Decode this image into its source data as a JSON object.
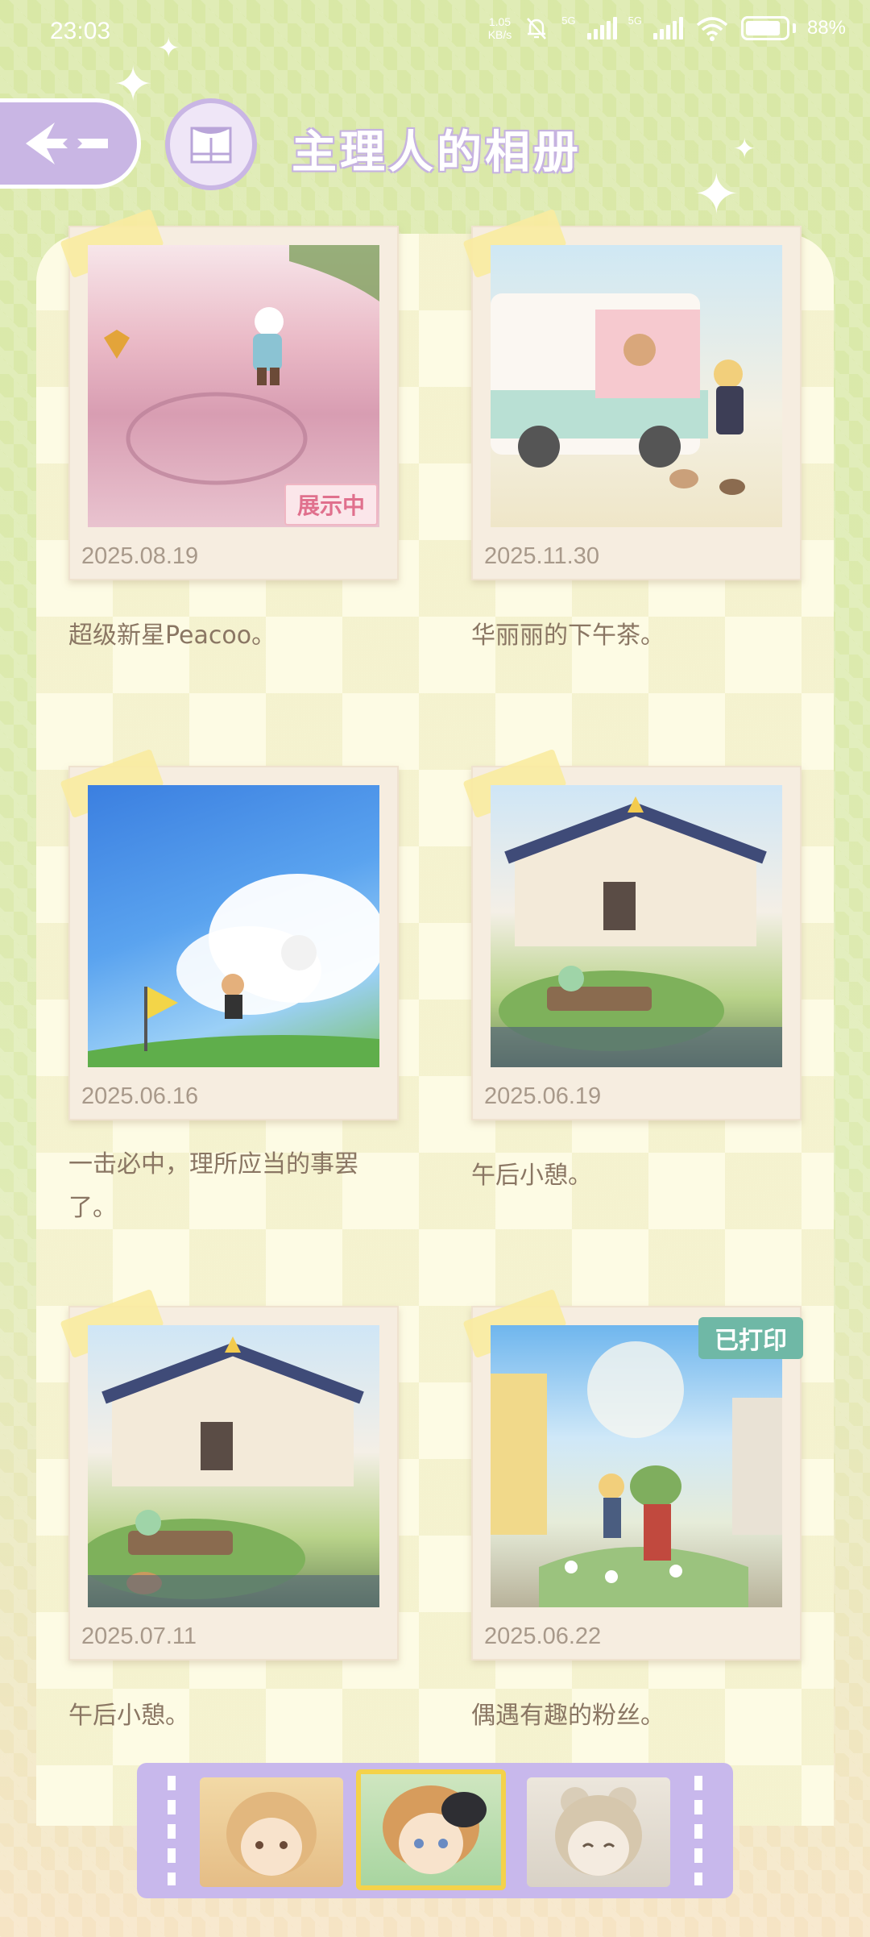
{
  "status_bar": {
    "time": "23:03",
    "net_speed_value": "1.05",
    "net_speed_unit": "KB/s",
    "sim1": "5G",
    "sim2": "5G",
    "battery": "88%"
  },
  "header": {
    "title": "主理人的相册"
  },
  "photos": [
    {
      "date": "2025.08.19",
      "caption": "超级新星Peacoo。",
      "badge": "展示中"
    },
    {
      "date": "2025.11.30",
      "caption": "华丽丽的下午茶。"
    },
    {
      "date": "2025.06.16",
      "caption": "一击必中，理所应当的事罢了。"
    },
    {
      "date": "2025.06.19",
      "caption": "午后小憩。"
    },
    {
      "date": "2025.07.11",
      "caption": "午后小憩。"
    },
    {
      "date": "2025.06.22",
      "caption": "偶遇有趣的粉丝。",
      "badge": "已打印"
    }
  ],
  "colors": {
    "accent_purple": "#c9b6e4",
    "badge_display": "#e0708d",
    "badge_printed": "#6fb8a6",
    "caption_text": "#8a7663"
  },
  "avatar_selector": {
    "selected_index": 1
  }
}
